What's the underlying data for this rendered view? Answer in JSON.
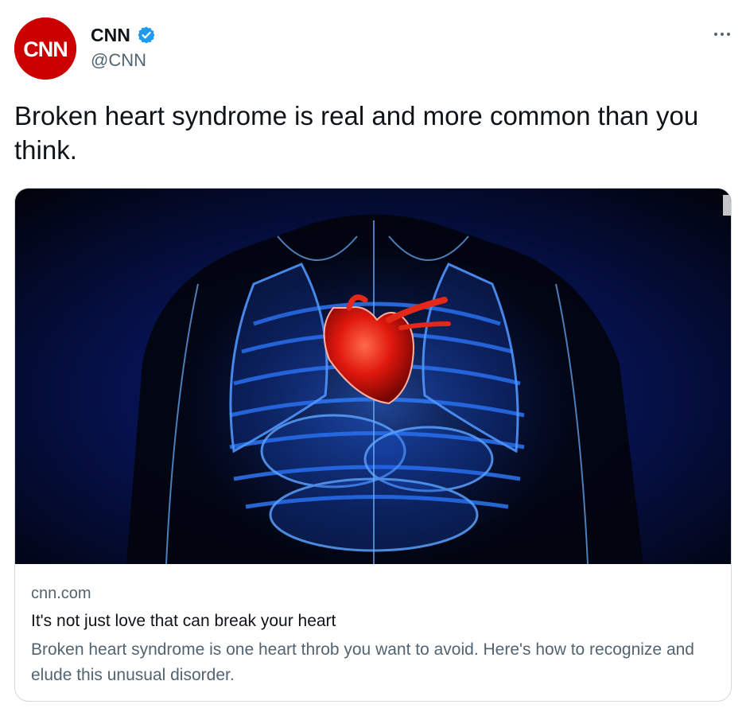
{
  "author": {
    "display_name": "CNN",
    "handle": "@CNN",
    "verified": true,
    "avatar_text": "CNN",
    "avatar_color": "#cc0000",
    "verified_badge_color": "#1d9bf0"
  },
  "tweet": {
    "text": "Broken heart syndrome is real and more common than you think."
  },
  "menu": {
    "icon": "more-horizontal-icon"
  },
  "link_card": {
    "image": "illustration-blue-xray-torso-red-heart",
    "domain": "cnn.com",
    "title": "It's not just love that can break your heart",
    "description": "Broken heart syndrome is one heart throb you want to avoid. Here's how to recognize and elude this unusual disorder."
  }
}
